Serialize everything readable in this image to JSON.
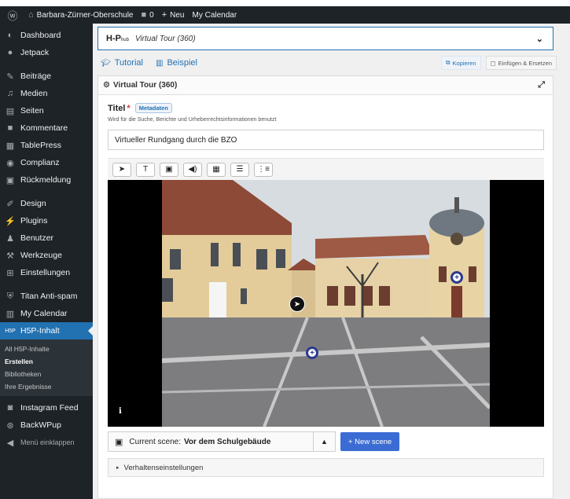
{
  "adminbar": {
    "site_name": "Barbara-Zürner-Oberschule",
    "comments_count": "0",
    "new_label": "Neu",
    "calendar_label": "My Calendar"
  },
  "sidebar": {
    "items": [
      {
        "label": "Dashboard",
        "icon": "dashboard-icon"
      },
      {
        "label": "Jetpack",
        "icon": "jetpack-icon"
      },
      {
        "label": "Beiträge",
        "icon": "pin-icon"
      },
      {
        "label": "Medien",
        "icon": "media-icon"
      },
      {
        "label": "Seiten",
        "icon": "pages-icon"
      },
      {
        "label": "Kommentare",
        "icon": "comments-icon"
      },
      {
        "label": "TablePress",
        "icon": "table-icon"
      },
      {
        "label": "Complianz",
        "icon": "complianz-icon"
      },
      {
        "label": "Rückmeldung",
        "icon": "feedback-icon"
      },
      {
        "label": "Design",
        "icon": "brush-icon"
      },
      {
        "label": "Plugins",
        "icon": "plugin-icon"
      },
      {
        "label": "Benutzer",
        "icon": "user-icon"
      },
      {
        "label": "Werkzeuge",
        "icon": "wrench-icon"
      },
      {
        "label": "Einstellungen",
        "icon": "settings-icon"
      },
      {
        "label": "Titan Anti-spam",
        "icon": "shield-icon"
      },
      {
        "label": "My Calendar",
        "icon": "calendar-icon"
      },
      {
        "label": "H5P-Inhalt",
        "icon": "h5p-icon"
      }
    ],
    "submenu": [
      "All H5P-Inhalte",
      "Erstellen",
      "Bibliotheken",
      "Ihre Ergebnisse"
    ],
    "after": [
      {
        "label": "Instagram Feed",
        "icon": "instagram-icon"
      },
      {
        "label": "BackWPup",
        "icon": "backup-icon"
      }
    ],
    "collapse_label": "Menü einklappen"
  },
  "editor": {
    "library_logo": "H-P",
    "library_logo_small": "hub",
    "library_name": "Virtual Tour (360)",
    "tutorial_label": "Tutorial",
    "example_label": "Beispiel",
    "copy_label": "Kopieren",
    "paste_label": "Einfügen & Ersetzen",
    "panel_title": "Virtual Tour (360)",
    "title_label": "Titel",
    "required_mark": "*",
    "metadata_label": "Metadaten",
    "title_description": "Wird für die Suche, Berichte und Urheberrechtsinformationen benutzt",
    "title_value": "Virtueller Rundgang durch die BZO",
    "tools": [
      "arrow-tool-icon",
      "text-tool-icon",
      "image-tool-icon",
      "audio-tool-icon",
      "video-tool-icon",
      "list-tool-icon",
      "numbered-list-tool-icon"
    ],
    "current_scene_label": "Current scene:",
    "current_scene_name": "Vor dem Schulgebäude",
    "new_scene_label": "+ New scene",
    "behaviour_label": "Verhaltenseinstellungen",
    "info_glyph": "i"
  }
}
